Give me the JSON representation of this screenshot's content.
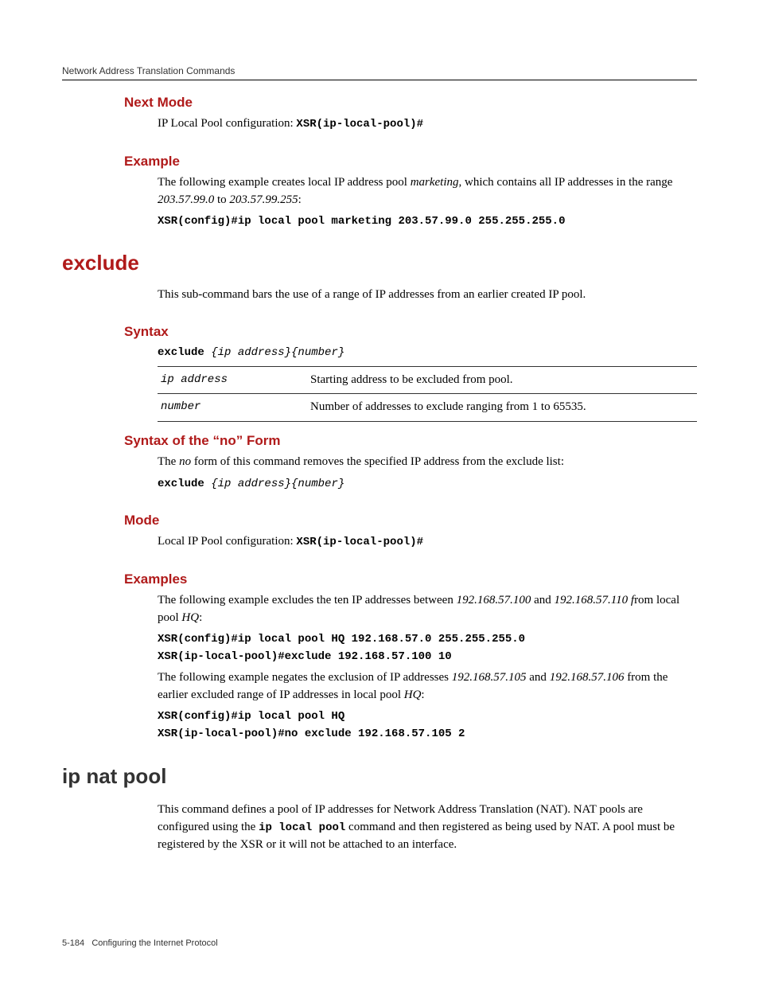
{
  "header": {
    "running_title": "Network Address Translation Commands"
  },
  "sections": {
    "next_mode": {
      "title": "Next Mode",
      "text_prefix": "IP Local Pool configuration: ",
      "prompt": "XSR(ip-local-pool)#"
    },
    "example1": {
      "title": "Example",
      "para_a": "The following example creates local IP address pool ",
      "para_em1": "marketing",
      "para_b": ", which contains all IP addresses in the range ",
      "para_em2": "203.57.99.0",
      "para_c": " to ",
      "para_em3": "203.57.99.255",
      "para_d": ":",
      "code": "XSR(config)#ip local pool marketing 203.57.99.0 255.255.255.0"
    },
    "exclude": {
      "title": "exclude",
      "intro": "This sub-command bars the use of a range of IP addresses from an earlier created IP pool."
    },
    "syntax": {
      "title": "Syntax",
      "cmd_bold": "exclude ",
      "cmd_rest": "{ip address}{number}",
      "rows": [
        {
          "param": "ip address",
          "desc": "Starting address to be excluded from pool."
        },
        {
          "param": "number",
          "desc": "Number of addresses to exclude ranging from 1 to 65535."
        }
      ]
    },
    "no_form": {
      "title": "Syntax of the “no” Form",
      "para_a": "The ",
      "para_em1": "no",
      "para_b": " form of this command removes the specified IP address from the exclude list:",
      "cmd_bold": "exclude ",
      "cmd_rest": "{ip address}{number}"
    },
    "mode": {
      "title": "Mode",
      "text_prefix": "Local IP Pool configuration: ",
      "prompt": "XSR(ip-local-pool)#"
    },
    "examples": {
      "title": "Examples",
      "p1_a": "The following example excludes the ten IP addresses between ",
      "p1_em1": "192.168.57.100",
      "p1_b": " and ",
      "p1_em2": "192.168.57.110 f",
      "p1_c": "rom local pool ",
      "p1_em3": "HQ",
      "p1_d": ":",
      "code1a": "XSR(config)#ip local pool HQ 192.168.57.0 255.255.255.0",
      "code1b": "XSR(ip-local-pool)#exclude 192.168.57.100 10",
      "p2_a": "The following example negates the exclusion of IP addresses ",
      "p2_em1": "192.168.57.105",
      "p2_b": " and ",
      "p2_em2": "192.168.57.106",
      "p2_c": " from the earlier excluded range of IP addresses in local pool ",
      "p2_em3": "HQ",
      "p2_d": ":",
      "code2a": "XSR(config)#ip local pool HQ",
      "code2b": "XSR(ip-local-pool)#no exclude 192.168.57.105 2"
    },
    "ipnatpool": {
      "title": "ip nat pool",
      "p_a": "This command defines a pool of IP addresses for Network Address Translation (NAT). NAT pools are configured using the ",
      "p_code": "ip local pool",
      "p_b": " command and then registered as being used by NAT. A pool must be registered by the XSR or it will not be attached to an interface."
    }
  },
  "footer": {
    "page": "5-184",
    "chapter": "Configuring the Internet Protocol"
  }
}
